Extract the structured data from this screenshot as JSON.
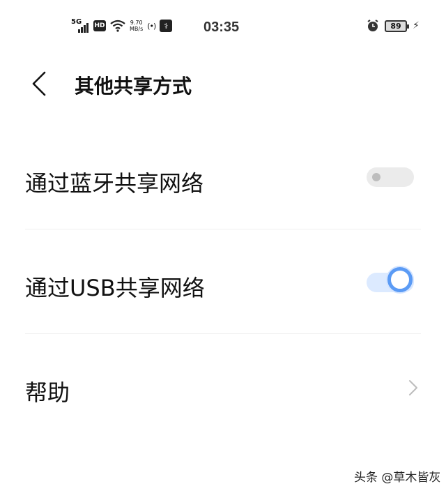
{
  "status_bar": {
    "network": "5G",
    "hd": "HD",
    "speed_value": "9.70",
    "speed_unit": "MB/s",
    "hotspot": "(•)",
    "time": "03:35",
    "battery": "89"
  },
  "header": {
    "title": "其他共享方式"
  },
  "settings": {
    "bluetooth": {
      "label": "通过蓝牙共享网络",
      "enabled": false
    },
    "usb": {
      "label": "通过USB共享网络",
      "enabled": true
    },
    "help": {
      "label": "帮助"
    }
  },
  "watermark": "头条 @草木皆灰",
  "colors": {
    "accent": "#5b9bf5",
    "toggle_on_track": "#dceaff",
    "toggle_off_track": "#ebebeb"
  }
}
